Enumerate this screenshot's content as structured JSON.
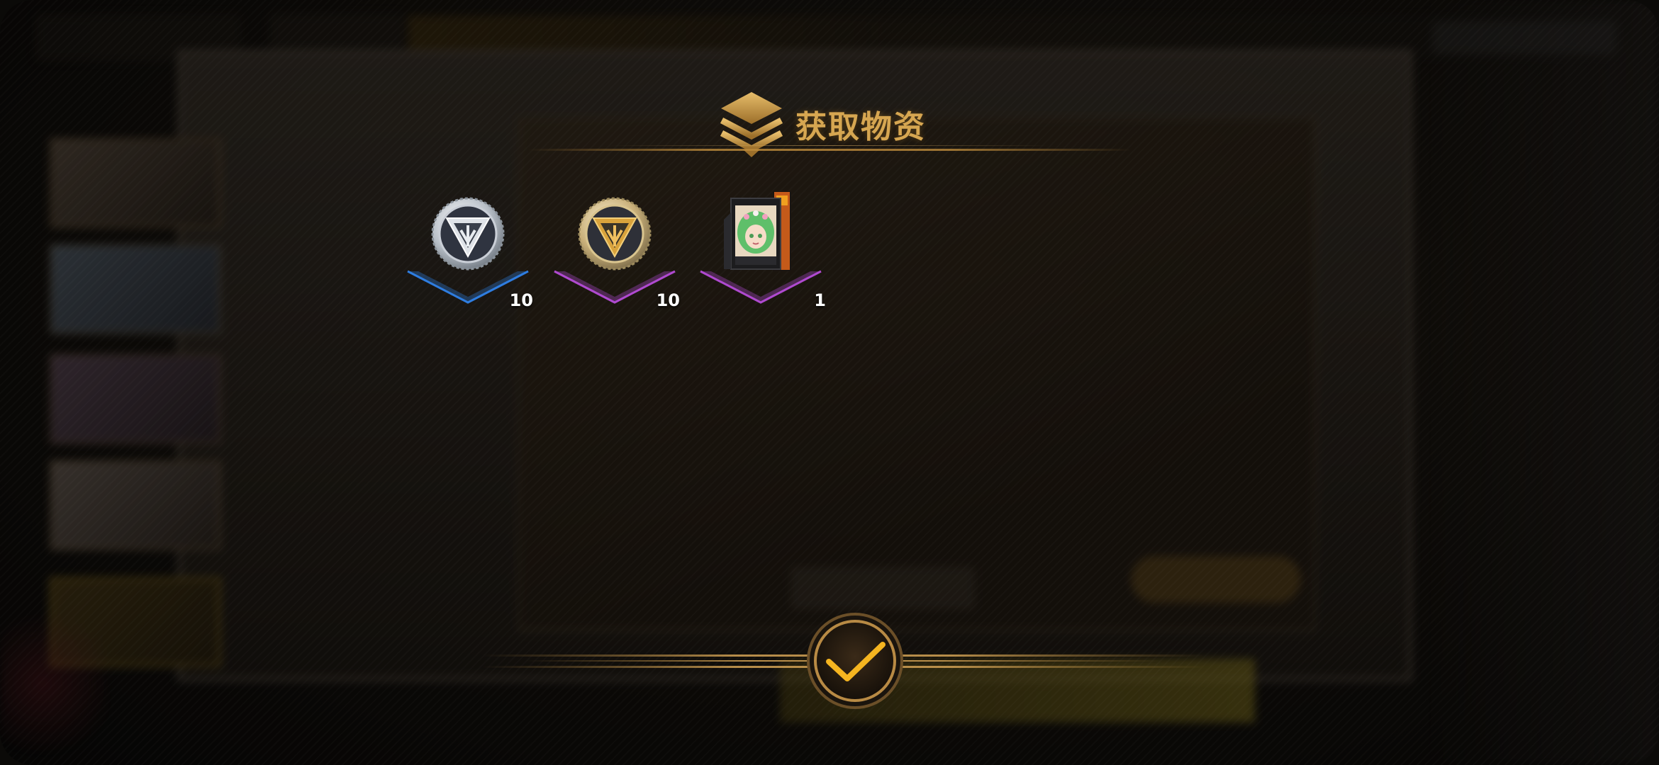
{
  "dialog": {
    "title": "获取物资",
    "title_icon": "stacked-layers-icon",
    "accent_color": "#d6a651"
  },
  "rewards": [
    {
      "name": "silver-badge-coin",
      "icon": "silver-emblem-coin-icon",
      "rarity_color": "#2f7de0",
      "count": "10"
    },
    {
      "name": "gold-badge-coin",
      "icon": "gold-emblem-coin-icon",
      "rarity_color": "#b04ad0",
      "count": "10"
    },
    {
      "name": "character-portrait-card",
      "icon": "green-hair-portrait-card-icon",
      "rarity_color": "#b04ad0",
      "count": "1"
    }
  ],
  "confirm": {
    "icon": "checkmark-icon",
    "color": "#f5b520"
  }
}
